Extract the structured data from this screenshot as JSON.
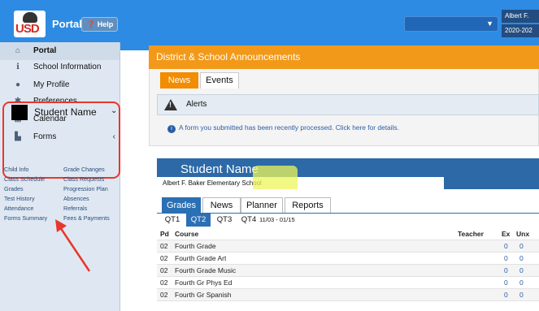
{
  "header": {
    "app_title": "Portal",
    "help_label": "Help",
    "user_name": "Albert F.",
    "school_year": "2020-202"
  },
  "sidebar": {
    "items": [
      {
        "label": "Portal",
        "icon": "home-icon"
      },
      {
        "label": "School Information",
        "icon": "info-icon"
      },
      {
        "label": "My Profile",
        "icon": "user-icon"
      },
      {
        "label": "Preferences",
        "icon": "gear-icon"
      },
      {
        "label": "Calendar",
        "icon": "calendar-icon"
      },
      {
        "label": "Forms",
        "icon": "document-icon"
      }
    ],
    "student": {
      "name": "Student Name",
      "links_left": [
        "Child Info",
        "Class Schedule",
        "Grades",
        "Test History",
        "Attendance",
        "Forms Summary"
      ],
      "links_right": [
        "Grade Changes",
        "Class Requests",
        "Progression Plan",
        "Absences",
        "Referrals",
        "Fees & Payments"
      ]
    }
  },
  "announcements": {
    "title": "District & School Announcements",
    "tabs": [
      "News",
      "Events"
    ],
    "alerts_label": "Alerts",
    "alert_message": "A form you submitted has been recently processed. Click here for details."
  },
  "student_panel": {
    "name": "Student Name",
    "school": "Albert F. Baker Elementary School",
    "tabs": [
      "Grades",
      "News",
      "Planner",
      "Reports"
    ],
    "quarters": [
      "QT1",
      "QT2",
      "QT3",
      "QT4"
    ],
    "date_range": "11/03 - 01/15",
    "columns": [
      "Pd",
      "Course",
      "Teacher",
      "Ex",
      "Unx"
    ],
    "rows": [
      {
        "pd": "02",
        "course": "Fourth Grade",
        "teacher": "",
        "ex": "0",
        "unx": "0"
      },
      {
        "pd": "02",
        "course": "Fourth Grade Art",
        "teacher": "",
        "ex": "0",
        "unx": "0"
      },
      {
        "pd": "02",
        "course": "Fourth Grade Music",
        "teacher": "",
        "ex": "0",
        "unx": "0"
      },
      {
        "pd": "02",
        "course": "Fourth Gr Phys Ed",
        "teacher": "",
        "ex": "0",
        "unx": "0"
      },
      {
        "pd": "02",
        "course": "Fourth Gr Spanish",
        "teacher": "",
        "ex": "0",
        "unx": "0"
      }
    ]
  },
  "colors": {
    "top_bar": "#2d8be3",
    "accent_orange": "#f2991a",
    "panel_blue": "#2d69a6",
    "highlight_box": "#e8372b"
  }
}
